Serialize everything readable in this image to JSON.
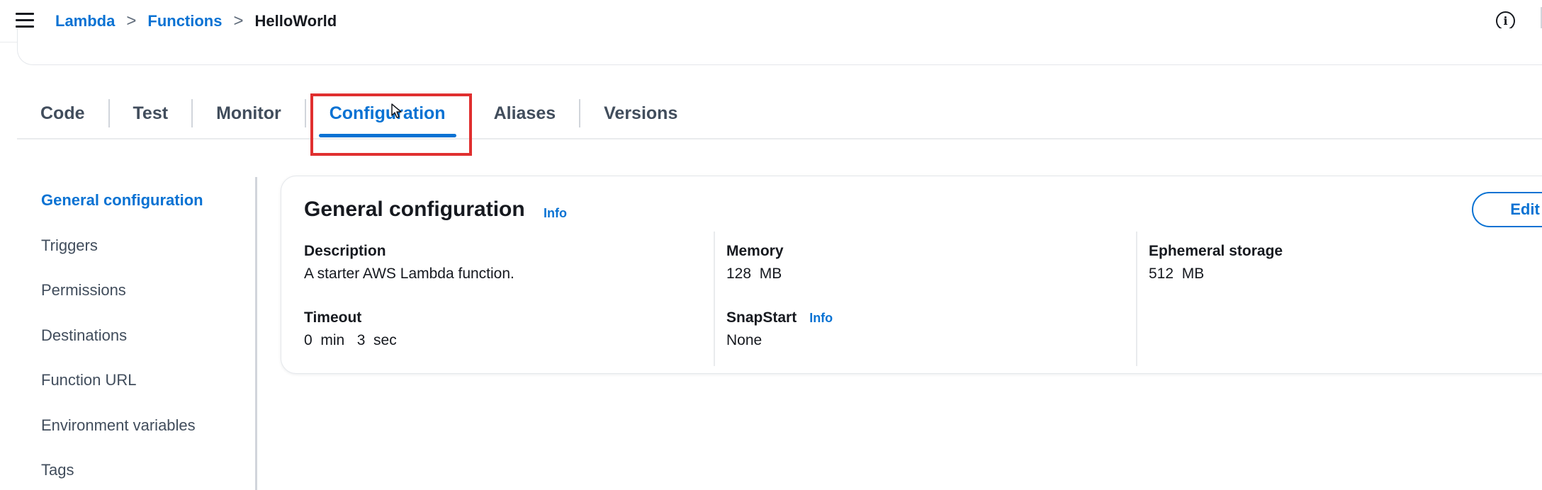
{
  "breadcrumb": {
    "items": [
      "Lambda",
      "Functions"
    ],
    "separator": ">",
    "current": "HelloWorld"
  },
  "header": {
    "info_icon": "info-circle-icon",
    "info_glyph": "i"
  },
  "tabs": [
    {
      "label": "Code"
    },
    {
      "label": "Test"
    },
    {
      "label": "Monitor"
    },
    {
      "label": "Configuration",
      "active": true
    },
    {
      "label": "Aliases"
    },
    {
      "label": "Versions"
    }
  ],
  "sidenav": {
    "items": [
      {
        "label": "General configuration",
        "active": true
      },
      {
        "label": "Triggers"
      },
      {
        "label": "Permissions"
      },
      {
        "label": "Destinations"
      },
      {
        "label": "Function URL"
      },
      {
        "label": "Environment variables"
      },
      {
        "label": "Tags"
      }
    ]
  },
  "general_config": {
    "title": "General configuration",
    "info_label": "Info",
    "edit_label": "Edit",
    "description": {
      "label": "Description",
      "value": "A starter AWS Lambda function."
    },
    "timeout": {
      "label": "Timeout",
      "value": "0  min   3  sec"
    },
    "memory": {
      "label": "Memory",
      "value": "128  MB"
    },
    "snapstart": {
      "label": "SnapStart",
      "info_label": "Info",
      "value": "None"
    },
    "ephemeral_storage": {
      "label": "Ephemeral storage",
      "value": "512  MB"
    }
  },
  "colors": {
    "accent": "#0972d3",
    "highlight": "#e02f2f",
    "text": "#16191f"
  }
}
